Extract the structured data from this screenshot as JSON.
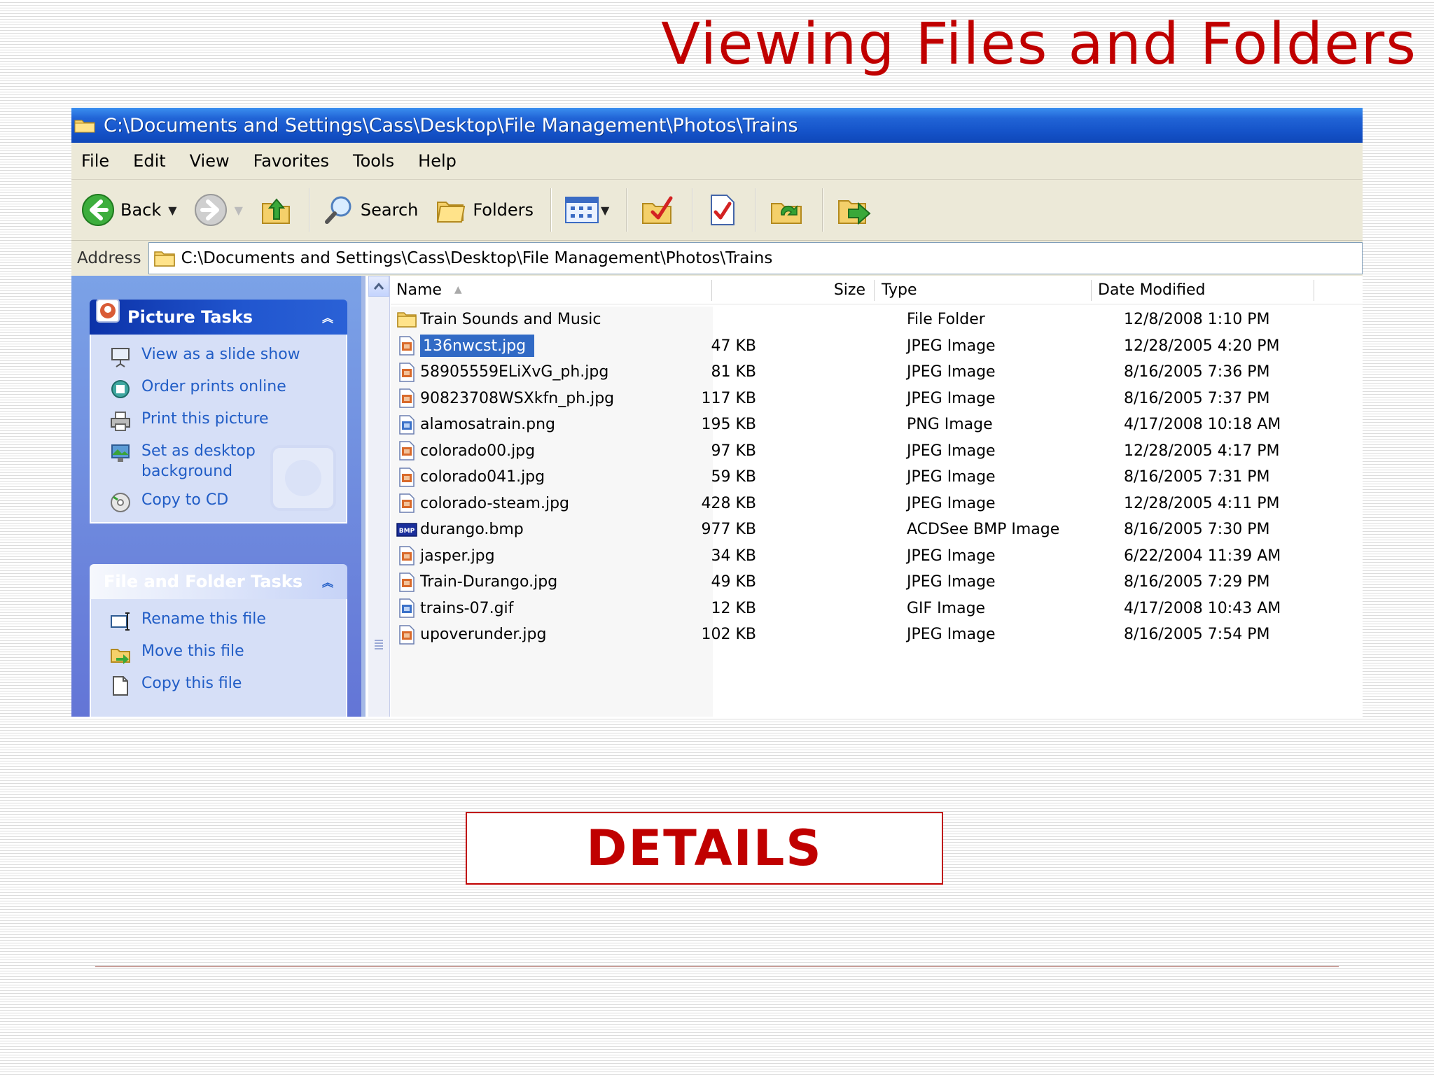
{
  "slide": {
    "title": "Viewing Files and Folders",
    "label": "DETAILS",
    "accent_color": "#c00000"
  },
  "window": {
    "title": "C:\\Documents and Settings\\Cass\\Desktop\\File Management\\Photos\\Trains",
    "menu": [
      "File",
      "Edit",
      "View",
      "Favorites",
      "Tools",
      "Help"
    ],
    "toolbar": {
      "back_label": "Back",
      "search_label": "Search",
      "folders_label": "Folders"
    },
    "address": {
      "label": "Address",
      "value": "C:\\Documents and Settings\\Cass\\Desktop\\File Management\\Photos\\Trains"
    }
  },
  "task_pane": {
    "picture_tasks": {
      "title": "Picture Tasks",
      "items": [
        {
          "label": "View as a slide show",
          "icon": "slideshow-icon"
        },
        {
          "label": "Order prints online",
          "icon": "order-prints-icon"
        },
        {
          "label": "Print this picture",
          "icon": "printer-icon"
        },
        {
          "label": "Set as desktop background",
          "icon": "desktop-background-icon"
        },
        {
          "label": "Copy to CD",
          "icon": "cd-icon"
        }
      ]
    },
    "file_folder_tasks": {
      "title": "File and Folder Tasks",
      "items": [
        {
          "label": "Rename this file",
          "icon": "rename-icon"
        },
        {
          "label": "Move this file",
          "icon": "move-icon"
        },
        {
          "label": "Copy this file",
          "icon": "copy-icon"
        }
      ]
    }
  },
  "file_list": {
    "columns": [
      "Name",
      "Size",
      "Type",
      "Date Modified"
    ],
    "sort_column": "Name",
    "selected_index": 1,
    "rows": [
      {
        "name": "Train Sounds and Music",
        "size": "",
        "type": "File Folder",
        "date": "12/8/2008 1:10 PM",
        "icon": "folder-icon"
      },
      {
        "name": "136nwcst.jpg",
        "size": "47 KB",
        "type": "JPEG Image",
        "date": "12/28/2005 4:20 PM",
        "icon": "jpeg-file-icon"
      },
      {
        "name": "58905559ELiXvG_ph.jpg",
        "size": "81 KB",
        "type": "JPEG Image",
        "date": "8/16/2005 7:36 PM",
        "icon": "jpeg-file-icon"
      },
      {
        "name": "90823708WSXkfn_ph.jpg",
        "size": "117 KB",
        "type": "JPEG Image",
        "date": "8/16/2005 7:37 PM",
        "icon": "jpeg-file-icon"
      },
      {
        "name": "alamosatrain.png",
        "size": "195 KB",
        "type": "PNG Image",
        "date": "4/17/2008 10:18 AM",
        "icon": "png-file-icon"
      },
      {
        "name": "colorado00.jpg",
        "size": "97 KB",
        "type": "JPEG Image",
        "date": "12/28/2005 4:17 PM",
        "icon": "jpeg-file-icon"
      },
      {
        "name": "colorado041.jpg",
        "size": "59 KB",
        "type": "JPEG Image",
        "date": "8/16/2005 7:31 PM",
        "icon": "jpeg-file-icon"
      },
      {
        "name": "colorado-steam.jpg",
        "size": "428 KB",
        "type": "JPEG Image",
        "date": "12/28/2005 4:11 PM",
        "icon": "jpeg-file-icon"
      },
      {
        "name": "durango.bmp",
        "size": "977 KB",
        "type": "ACDSee BMP Image",
        "date": "8/16/2005 7:30 PM",
        "icon": "bmp-file-icon"
      },
      {
        "name": "jasper.jpg",
        "size": "34 KB",
        "type": "JPEG Image",
        "date": "6/22/2004 11:39 AM",
        "icon": "jpeg-file-icon"
      },
      {
        "name": "Train-Durango.jpg",
        "size": "49 KB",
        "type": "JPEG Image",
        "date": "8/16/2005 7:29 PM",
        "icon": "jpeg-file-icon"
      },
      {
        "name": "trains-07.gif",
        "size": "12 KB",
        "type": "GIF Image",
        "date": "4/17/2008 10:43 AM",
        "icon": "gif-file-icon"
      },
      {
        "name": "upoverunder.jpg",
        "size": "102 KB",
        "type": "JPEG Image",
        "date": "8/16/2005 7:54 PM",
        "icon": "jpeg-file-icon"
      }
    ]
  }
}
